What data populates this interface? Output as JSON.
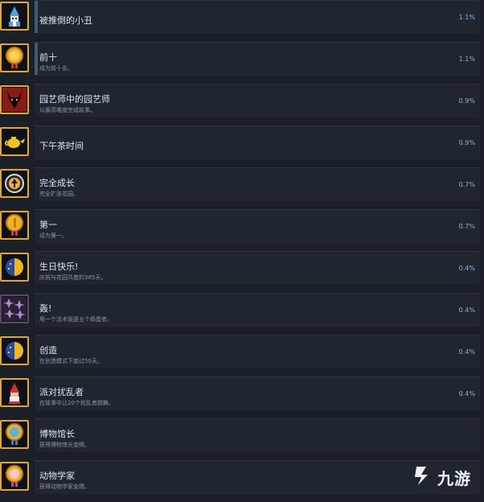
{
  "achievements": [
    {
      "title": "被推倒的小丑",
      "desc": "",
      "percent": "1.1%",
      "icon": "clown-gnome-icon"
    },
    {
      "title": "前十",
      "desc": "成为前十名。",
      "percent": "1.1%",
      "icon": "gold-medal-10-icon"
    },
    {
      "title": "园艺师中的园艺师",
      "desc": "以最高难度完成故事。",
      "percent": "0.9%",
      "icon": "horned-mask-icon"
    },
    {
      "title": "下午茶时间",
      "desc": "",
      "percent": "0.9%",
      "icon": "teapot-icon"
    },
    {
      "title": "完全成长",
      "desc": "完全扩张花园。",
      "percent": "0.7%",
      "icon": "up-arrow-badge-icon"
    },
    {
      "title": "第一",
      "desc": "成为第一。",
      "percent": "0.7%",
      "icon": "gold-medal-1-icon"
    },
    {
      "title": "生日快乐!",
      "desc": "庆祝与花园共度的365天。",
      "percent": "0.4%",
      "icon": "half-moon-icon"
    },
    {
      "title": "轰!",
      "desc": "用一个法术驱逐五个捣蛋者。",
      "percent": "0.4%",
      "icon": "purple-sparkles-icon"
    },
    {
      "title": "创造",
      "desc": "在创造模式下度过50天。",
      "percent": "0.4%",
      "icon": "half-moon-icon"
    },
    {
      "title": "派对扰乱者",
      "desc": "在故事中让20个扰乱者跳舞。",
      "percent": "0.4%",
      "icon": "red-gnome-icon"
    },
    {
      "title": "博物馆长",
      "desc": "获得博物馆长金牌。",
      "percent": "",
      "icon": "blue-medal-icon"
    },
    {
      "title": "动物学家",
      "desc": "获得动物学家金牌。",
      "percent": "",
      "icon": "pink-medal-icon"
    }
  ],
  "watermark": {
    "text": "九游",
    "icon": "jiuyou-logo-icon"
  }
}
